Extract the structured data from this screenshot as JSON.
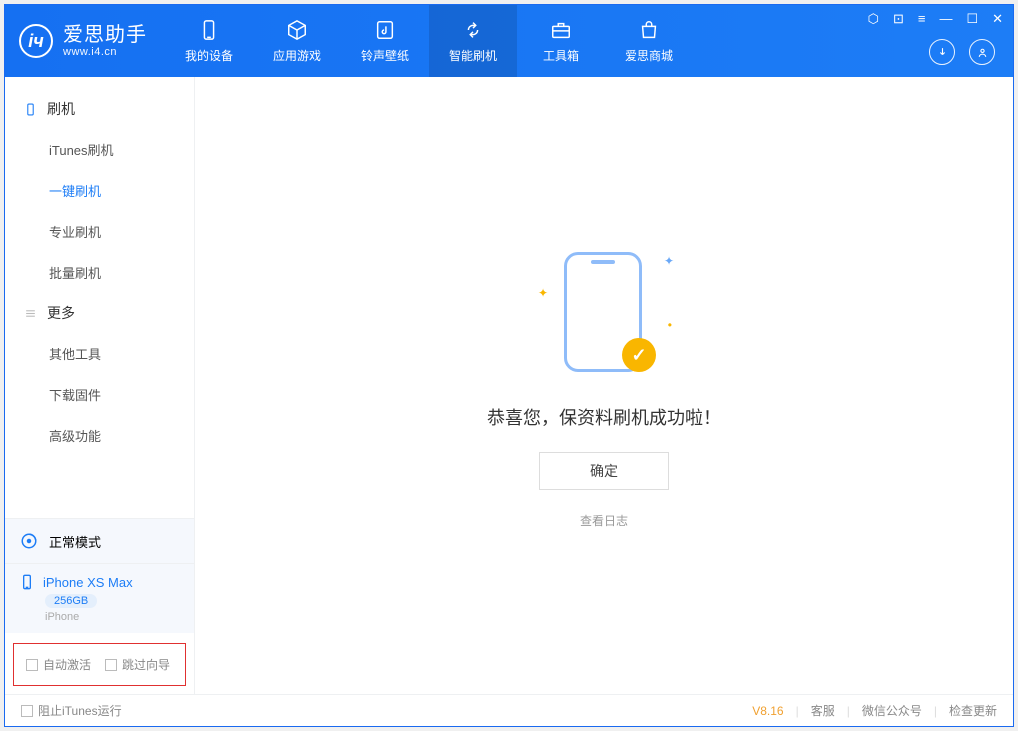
{
  "app": {
    "name": "爱思助手",
    "url": "www.i4.cn"
  },
  "winctrl_glyphs": [
    "⬡",
    "⊡",
    "≡",
    "—",
    "☐",
    "✕"
  ],
  "tabs": [
    {
      "label": "我的设备",
      "icon": "device"
    },
    {
      "label": "应用游戏",
      "icon": "cube"
    },
    {
      "label": "铃声壁纸",
      "icon": "music"
    },
    {
      "label": "智能刷机",
      "icon": "refresh",
      "active": true
    },
    {
      "label": "工具箱",
      "icon": "toolbox"
    },
    {
      "label": "爱思商城",
      "icon": "bag"
    }
  ],
  "sidebar": {
    "sections": [
      {
        "title": "刷机",
        "icon": "phone-outline",
        "items": [
          {
            "label": "iTunes刷机"
          },
          {
            "label": "一键刷机",
            "active": true
          },
          {
            "label": "专业刷机"
          },
          {
            "label": "批量刷机"
          }
        ]
      },
      {
        "title": "更多",
        "icon": "hamburger",
        "items": [
          {
            "label": "其他工具"
          },
          {
            "label": "下载固件"
          },
          {
            "label": "高级功能"
          }
        ]
      }
    ],
    "mode": {
      "label": "正常模式"
    },
    "device": {
      "name": "iPhone XS Max",
      "storage": "256GB",
      "type": "iPhone"
    },
    "checks": {
      "auto_activate": "自动激活",
      "skip_guide": "跳过向导"
    }
  },
  "main": {
    "message": "恭喜您，保资料刷机成功啦！",
    "ok": "确定",
    "view_log": "查看日志"
  },
  "status": {
    "block_itunes": "阻止iTunes运行",
    "version": "V8.16",
    "links": [
      "客服",
      "微信公众号",
      "检查更新"
    ]
  }
}
